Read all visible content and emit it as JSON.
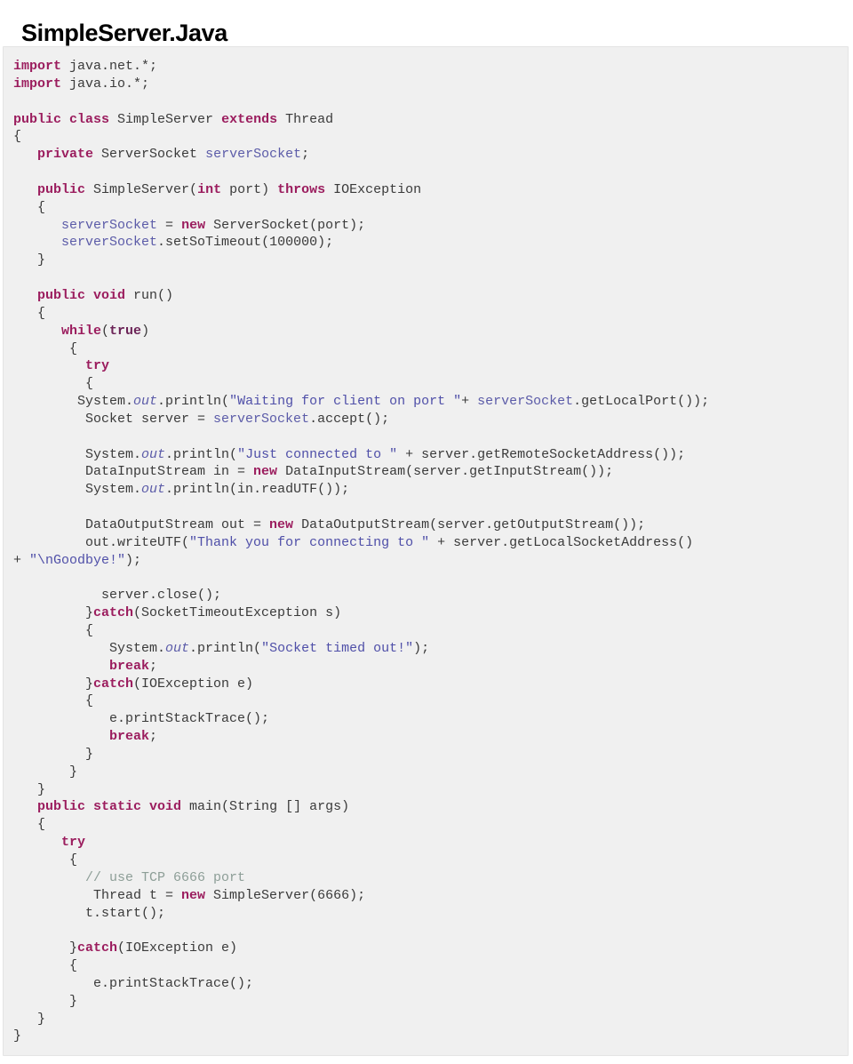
{
  "document": {
    "title": "SimpleServer.Java"
  },
  "code_block": {
    "language": "java",
    "background_color": "#f0f0f0",
    "border_color": "#e4e4e4",
    "colors": {
      "keyword": "#9b1d5e",
      "keyword_alt": "#6b2357",
      "variable": "#5b5ba8",
      "string": "#4f4fa8",
      "field": "#5b5ba8",
      "comment": "#8d9e97",
      "plain": "#3a3a3a"
    },
    "lines": [
      [
        {
          "t": "import",
          "c": "tok-kw"
        },
        {
          "t": " java.net.*;",
          "c": "tok-plain"
        }
      ],
      [
        {
          "t": "import",
          "c": "tok-kw"
        },
        {
          "t": " java.io.*;",
          "c": "tok-plain"
        }
      ],
      [
        {
          "t": "",
          "c": "tok-plain"
        }
      ],
      [
        {
          "t": "public class",
          "c": "tok-kw"
        },
        {
          "t": " SimpleServer ",
          "c": "tok-plain"
        },
        {
          "t": "extends",
          "c": "tok-kw"
        },
        {
          "t": " Thread",
          "c": "tok-plain"
        }
      ],
      [
        {
          "t": "{",
          "c": "tok-plain"
        }
      ],
      [
        {
          "t": "   ",
          "c": "tok-plain"
        },
        {
          "t": "private",
          "c": "tok-kw"
        },
        {
          "t": " ServerSocket ",
          "c": "tok-plain"
        },
        {
          "t": "serverSocket",
          "c": "tok-var"
        },
        {
          "t": ";",
          "c": "tok-plain"
        }
      ],
      [
        {
          "t": "",
          "c": "tok-plain"
        }
      ],
      [
        {
          "t": "   ",
          "c": "tok-plain"
        },
        {
          "t": "public",
          "c": "tok-kw"
        },
        {
          "t": " SimpleServer(",
          "c": "tok-plain"
        },
        {
          "t": "int",
          "c": "tok-kw"
        },
        {
          "t": " port) ",
          "c": "tok-plain"
        },
        {
          "t": "throws",
          "c": "tok-kw"
        },
        {
          "t": " IOException",
          "c": "tok-plain"
        }
      ],
      [
        {
          "t": "   {",
          "c": "tok-plain"
        }
      ],
      [
        {
          "t": "      ",
          "c": "tok-plain"
        },
        {
          "t": "serverSocket",
          "c": "tok-var"
        },
        {
          "t": " = ",
          "c": "tok-plain"
        },
        {
          "t": "new",
          "c": "tok-kw"
        },
        {
          "t": " ServerSocket(port);",
          "c": "tok-plain"
        }
      ],
      [
        {
          "t": "      ",
          "c": "tok-plain"
        },
        {
          "t": "serverSocket",
          "c": "tok-var"
        },
        {
          "t": ".setSoTimeout(100000);",
          "c": "tok-plain"
        }
      ],
      [
        {
          "t": "   }",
          "c": "tok-plain"
        }
      ],
      [
        {
          "t": "",
          "c": "tok-plain"
        }
      ],
      [
        {
          "t": "   ",
          "c": "tok-plain"
        },
        {
          "t": "public void",
          "c": "tok-kw"
        },
        {
          "t": " run()",
          "c": "tok-plain"
        }
      ],
      [
        {
          "t": "   {",
          "c": "tok-plain"
        }
      ],
      [
        {
          "t": "      ",
          "c": "tok-plain"
        },
        {
          "t": "while",
          "c": "tok-kw"
        },
        {
          "t": "(",
          "c": "tok-plain"
        },
        {
          "t": "true",
          "c": "tok-kw2"
        },
        {
          "t": ")",
          "c": "tok-plain"
        }
      ],
      [
        {
          "t": "       {",
          "c": "tok-plain"
        }
      ],
      [
        {
          "t": "         ",
          "c": "tok-plain"
        },
        {
          "t": "try",
          "c": "tok-kw"
        }
      ],
      [
        {
          "t": "         {",
          "c": "tok-plain"
        }
      ],
      [
        {
          "t": "        System.",
          "c": "tok-plain"
        },
        {
          "t": "out",
          "c": "tok-field"
        },
        {
          "t": ".println(",
          "c": "tok-plain"
        },
        {
          "t": "\"Waiting for client on port \"",
          "c": "tok-str"
        },
        {
          "t": "+ ",
          "c": "tok-plain"
        },
        {
          "t": "serverSocket",
          "c": "tok-var"
        },
        {
          "t": ".getLocalPort());",
          "c": "tok-plain"
        }
      ],
      [
        {
          "t": "         Socket server = ",
          "c": "tok-plain"
        },
        {
          "t": "serverSocket",
          "c": "tok-var"
        },
        {
          "t": ".accept();",
          "c": "tok-plain"
        }
      ],
      [
        {
          "t": "",
          "c": "tok-plain"
        }
      ],
      [
        {
          "t": "         System.",
          "c": "tok-plain"
        },
        {
          "t": "out",
          "c": "tok-field"
        },
        {
          "t": ".println(",
          "c": "tok-plain"
        },
        {
          "t": "\"Just connected to \"",
          "c": "tok-str"
        },
        {
          "t": " + server.getRemoteSocketAddress());",
          "c": "tok-plain"
        }
      ],
      [
        {
          "t": "         DataInputStream in = ",
          "c": "tok-plain"
        },
        {
          "t": "new",
          "c": "tok-kw"
        },
        {
          "t": " DataInputStream(server.getInputStream());",
          "c": "tok-plain"
        }
      ],
      [
        {
          "t": "         System.",
          "c": "tok-plain"
        },
        {
          "t": "out",
          "c": "tok-field"
        },
        {
          "t": ".println(in.readUTF());",
          "c": "tok-plain"
        }
      ],
      [
        {
          "t": "",
          "c": "tok-plain"
        }
      ],
      [
        {
          "t": "         DataOutputStream out = ",
          "c": "tok-plain"
        },
        {
          "t": "new",
          "c": "tok-kw"
        },
        {
          "t": " DataOutputStream(server.getOutputStream());",
          "c": "tok-plain"
        }
      ],
      [
        {
          "t": "         out.writeUTF(",
          "c": "tok-plain"
        },
        {
          "t": "\"Thank you for connecting to \"",
          "c": "tok-str"
        },
        {
          "t": " + server.getLocalSocketAddress()",
          "c": "tok-plain"
        }
      ],
      [
        {
          "t": "+ ",
          "c": "tok-plain"
        },
        {
          "t": "\"\\nGoodbye!\"",
          "c": "tok-str"
        },
        {
          "t": ");",
          "c": "tok-plain"
        }
      ],
      [
        {
          "t": "",
          "c": "tok-plain"
        }
      ],
      [
        {
          "t": "           server.close();",
          "c": "tok-plain"
        }
      ],
      [
        {
          "t": "         }",
          "c": "tok-plain"
        },
        {
          "t": "catch",
          "c": "tok-kw"
        },
        {
          "t": "(SocketTimeoutException s)",
          "c": "tok-plain"
        }
      ],
      [
        {
          "t": "         {",
          "c": "tok-plain"
        }
      ],
      [
        {
          "t": "            System.",
          "c": "tok-plain"
        },
        {
          "t": "out",
          "c": "tok-field"
        },
        {
          "t": ".println(",
          "c": "tok-plain"
        },
        {
          "t": "\"Socket timed out!\"",
          "c": "tok-str"
        },
        {
          "t": ");",
          "c": "tok-plain"
        }
      ],
      [
        {
          "t": "            ",
          "c": "tok-plain"
        },
        {
          "t": "break",
          "c": "tok-kw"
        },
        {
          "t": ";",
          "c": "tok-plain"
        }
      ],
      [
        {
          "t": "         }",
          "c": "tok-plain"
        },
        {
          "t": "catch",
          "c": "tok-kw"
        },
        {
          "t": "(IOException e)",
          "c": "tok-plain"
        }
      ],
      [
        {
          "t": "         {",
          "c": "tok-plain"
        }
      ],
      [
        {
          "t": "            e.printStackTrace();",
          "c": "tok-plain"
        }
      ],
      [
        {
          "t": "            ",
          "c": "tok-plain"
        },
        {
          "t": "break",
          "c": "tok-kw"
        },
        {
          "t": ";",
          "c": "tok-plain"
        }
      ],
      [
        {
          "t": "         }",
          "c": "tok-plain"
        }
      ],
      [
        {
          "t": "       }",
          "c": "tok-plain"
        }
      ],
      [
        {
          "t": "   }",
          "c": "tok-plain"
        }
      ],
      [
        {
          "t": "   ",
          "c": "tok-plain"
        },
        {
          "t": "public static void",
          "c": "tok-kw"
        },
        {
          "t": " main(String [] args)",
          "c": "tok-plain"
        }
      ],
      [
        {
          "t": "   {",
          "c": "tok-plain"
        }
      ],
      [
        {
          "t": "      ",
          "c": "tok-plain"
        },
        {
          "t": "try",
          "c": "tok-kw"
        }
      ],
      [
        {
          "t": "       {",
          "c": "tok-plain"
        }
      ],
      [
        {
          "t": "         ",
          "c": "tok-plain"
        },
        {
          "t": "// use TCP 6666 port",
          "c": "tok-com"
        }
      ],
      [
        {
          "t": "          Thread t = ",
          "c": "tok-plain"
        },
        {
          "t": "new",
          "c": "tok-kw"
        },
        {
          "t": " SimpleServer(6666);",
          "c": "tok-plain"
        }
      ],
      [
        {
          "t": "         t.start();",
          "c": "tok-plain"
        }
      ],
      [
        {
          "t": "",
          "c": "tok-plain"
        }
      ],
      [
        {
          "t": "       }",
          "c": "tok-plain"
        },
        {
          "t": "catch",
          "c": "tok-kw"
        },
        {
          "t": "(IOException e)",
          "c": "tok-plain"
        }
      ],
      [
        {
          "t": "       {",
          "c": "tok-plain"
        }
      ],
      [
        {
          "t": "          e.printStackTrace();",
          "c": "tok-plain"
        }
      ],
      [
        {
          "t": "       }",
          "c": "tok-plain"
        }
      ],
      [
        {
          "t": "   }",
          "c": "tok-plain"
        }
      ],
      [
        {
          "t": "}",
          "c": "tok-plain"
        }
      ]
    ]
  }
}
